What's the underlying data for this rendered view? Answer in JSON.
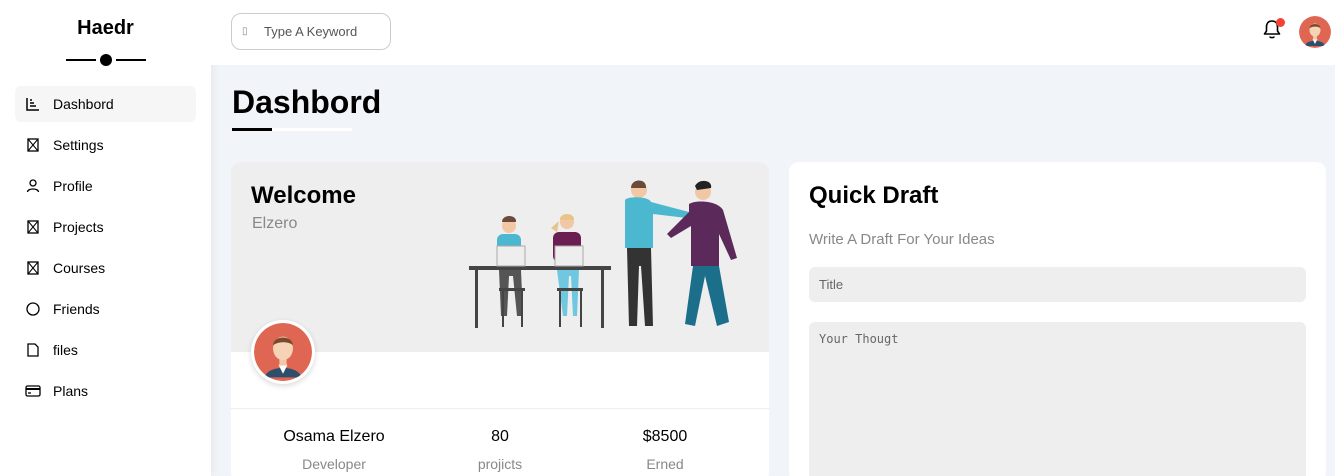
{
  "brand": {
    "name": "Haedr"
  },
  "sidebar": {
    "items": [
      {
        "label": "Dashbord",
        "icon": "chart-icon",
        "active": true
      },
      {
        "label": "Settings",
        "icon": "missing-glyph-icon"
      },
      {
        "label": "Profile",
        "icon": "user-icon"
      },
      {
        "label": "Projects",
        "icon": "missing-glyph-icon"
      },
      {
        "label": "Courses",
        "icon": "missing-glyph-icon"
      },
      {
        "label": "Friends",
        "icon": "circle-icon"
      },
      {
        "label": "files",
        "icon": "file-icon"
      },
      {
        "label": "Plans",
        "icon": "credit-card-icon"
      }
    ]
  },
  "header": {
    "search": {
      "placeholder": "Type A Keyword"
    },
    "notification": {
      "has_unread": true,
      "badge_color": "#f44336"
    }
  },
  "page": {
    "title": "Dashbord"
  },
  "welcome": {
    "heading": "Welcome",
    "subheading": "Elzero",
    "stats": [
      {
        "value": "Osama Elzero",
        "label": "Developer"
      },
      {
        "value": "80",
        "label": "projicts"
      },
      {
        "value": "$8500",
        "label": "Erned"
      }
    ]
  },
  "draft": {
    "heading": "Quick Draft",
    "subheading": "Write A Draft For Your Ideas",
    "title_placeholder": "Title",
    "text_placeholder": "Your Thougt"
  },
  "colors": {
    "background": "#f1f4f8",
    "card": "#ffffff",
    "panel_gray": "#eeeeee",
    "muted_text": "#888888"
  }
}
